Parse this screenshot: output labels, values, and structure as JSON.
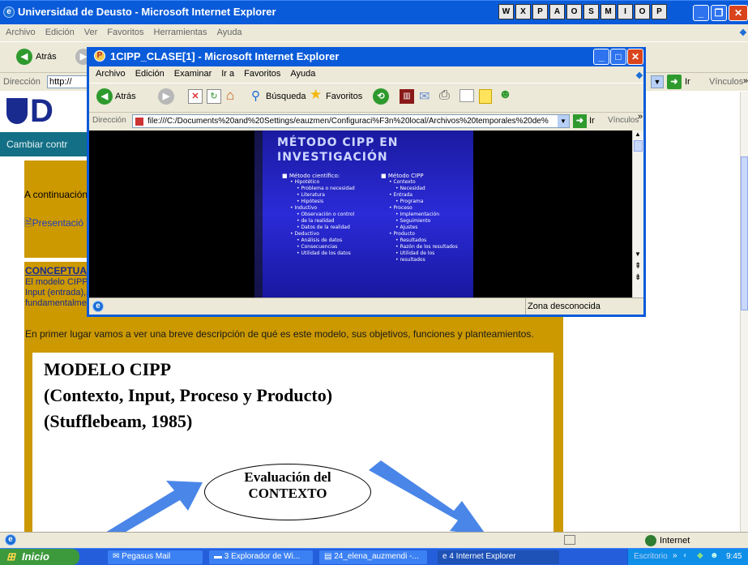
{
  "main_window": {
    "title": "Universidad de Deusto - Microsoft Internet Explorer",
    "menu": [
      "Archivo",
      "Edición",
      "Ver",
      "Favoritos",
      "Herramientas",
      "Ayuda"
    ],
    "back_label": "Atrás",
    "address_label": "Dirección",
    "address_value": "http://",
    "go_label": "Ir",
    "links_label": "Vínculos",
    "status_zone": "Internet"
  },
  "tray_icons": [
    "W",
    "X",
    "P",
    "A",
    "O",
    "S",
    "M",
    "I",
    "O",
    "P"
  ],
  "page": {
    "nav_link": "Cambiar contr",
    "intro_text": "A continuación",
    "presentation_link": "Presentació",
    "section_heading": "CONCEPTUAL",
    "body_line1": "El modelo CIPP",
    "body_line2": "Input (entrada),",
    "body_line3": "fundamentalme",
    "paragraph": "En primer lugar vamos a ver una breve descripción de qué es este modelo, sus objetivos, funciones y planteamientos.",
    "figure_title1": "MODELO CIPP",
    "figure_title2": "(Contexto, Input, Proceso y Producto)",
    "figure_title3": "(Stufflebeam, 1985)",
    "ellipse_line1": "Evaluación del",
    "ellipse_line2": "CONTEXTO"
  },
  "popup": {
    "title": "1CIPP_CLASE[1] - Microsoft Internet Explorer",
    "menu": [
      "Archivo",
      "Edición",
      "Examinar",
      "Ir a",
      "Favoritos",
      "Ayuda"
    ],
    "back_label": "Atrás",
    "search_label": "Búsqueda",
    "favorites_label": "Favoritos",
    "address_label": "Dirección",
    "address_value": "file:///C:/Documents%20and%20Settings/eauzmen/Configuraci%F3n%20local/Archivos%20temporales%20de%",
    "go_label": "Ir",
    "links_label": "Vínculos",
    "status_zone": "Zona desconocida"
  },
  "slide": {
    "title1": "MÉTODO CIPP EN",
    "title2": "INVESTIGACIÓN",
    "left_header": "Método científico:",
    "left_items": [
      {
        "level": 2,
        "text": "Hipotético"
      },
      {
        "level": 3,
        "text": "Problema o necesidad"
      },
      {
        "level": 3,
        "text": "Literatura"
      },
      {
        "level": 3,
        "text": "Hipótesis"
      },
      {
        "level": 2,
        "text": "Inductivo"
      },
      {
        "level": 3,
        "text": "Observación o control"
      },
      {
        "level": 3,
        "text": "de la realidad"
      },
      {
        "level": 3,
        "text": "Datos de la realidad"
      },
      {
        "level": 2,
        "text": "Deductivo"
      },
      {
        "level": 3,
        "text": "Análisis de datos"
      },
      {
        "level": 3,
        "text": "Consecuencias"
      },
      {
        "level": 3,
        "text": "Utilidad de los datos"
      }
    ],
    "right_header": "Método CIPP",
    "right_items": [
      {
        "level": 2,
        "text": "Contexto"
      },
      {
        "level": 3,
        "text": "Necesidad"
      },
      {
        "level": 2,
        "text": "Entrada"
      },
      {
        "level": 3,
        "text": "Programa"
      },
      {
        "level": 2,
        "text": "Proceso"
      },
      {
        "level": 3,
        "text": "Implementación"
      },
      {
        "level": 3,
        "text": "Seguimiento"
      },
      {
        "level": 3,
        "text": "Ajustes"
      },
      {
        "level": 2,
        "text": "Producto"
      },
      {
        "level": 3,
        "text": "Resultados"
      },
      {
        "level": 3,
        "text": "Razón de los resultados"
      },
      {
        "level": 3,
        "text": "Utilidad de los"
      },
      {
        "level": 3,
        "text": "resultados"
      }
    ]
  },
  "taskbar": {
    "start_label": "Inicio",
    "tasks": [
      {
        "label": "Pegasus Mail",
        "icon": "mail-icon",
        "active": false
      },
      {
        "label": "3 Explorador de Wi...",
        "icon": "folder-icon",
        "active": false
      },
      {
        "label": "24_elena_auzmendi -...",
        "icon": "document-icon",
        "active": false
      },
      {
        "label": "4 Internet Explorer",
        "icon": "ie-icon",
        "active": true
      }
    ],
    "desktop_label": "Escritorio",
    "clock": "9:45"
  },
  "colors": {
    "xp_blue": "#0a5bd9",
    "deusto_gold": "#cc9900",
    "nav_teal": "#136f85",
    "taskbar_blue": "#245edb",
    "start_green": "#3c9a3c"
  }
}
